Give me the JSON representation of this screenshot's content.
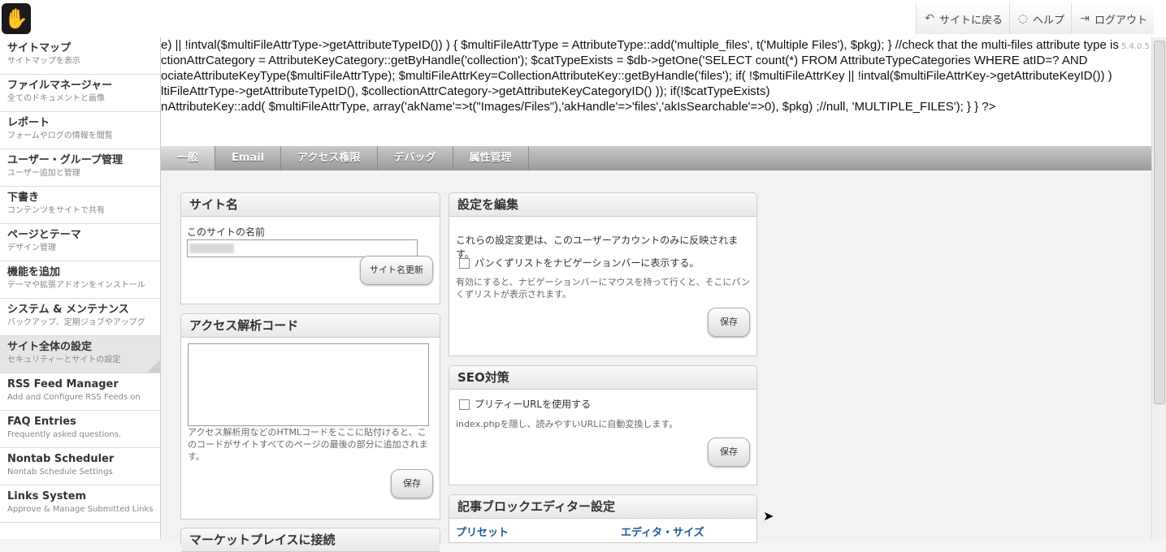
{
  "header": {
    "logo_glyph": "✋",
    "nav": [
      {
        "label": "サイトに戻る",
        "icon": "return-icon"
      },
      {
        "label": "ヘルプ",
        "icon": "help-icon"
      },
      {
        "label": "ログアウト",
        "icon": "logout-icon"
      }
    ]
  },
  "sidebar": {
    "items": [
      {
        "title": "サイトマップ",
        "sub": "サイトマップを表示"
      },
      {
        "title": "ファイルマネージャー",
        "sub": "全てのドキュメントと画像"
      },
      {
        "title": "レポート",
        "sub": "フォームやログの情報を閲覧"
      },
      {
        "title": "ユーザー・グループ管理",
        "sub": "ユーザー追加と管理"
      },
      {
        "title": "下書き",
        "sub": "コンテンツをサイトで共有"
      },
      {
        "title": "ページとテーマ",
        "sub": "デザイン管理"
      },
      {
        "title": "機能を追加",
        "sub": "テーマや拡張アドオンをインストール"
      },
      {
        "title": "システム & メンテナンス",
        "sub": "バックアップ、定期ジョブやアップグ"
      },
      {
        "title": "サイト全体の設定",
        "sub": "セキュリティーとサイトの設定",
        "active": true
      },
      {
        "title": "RSS Feed Manager",
        "sub": "Add and Configure RSS Feeds on"
      },
      {
        "title": "FAQ Entries",
        "sub": "Frequently asked questions."
      },
      {
        "title": "Nontab Scheduler",
        "sub": "Nontab Schedule Settings"
      },
      {
        "title": "Links System",
        "sub": "Approve & Manage Submitted Links"
      }
    ]
  },
  "error_lines": [
    "e) || !intval($multiFileAttrType->getAttributeTypeID()) ) { $multiFileAttrType = AttributeType::add('multiple_files', t('Multiple Files'), $pkg); } //check that the multi-files attribute type is",
    "ctionAttrCategory = AttributeKeyCategory::getByHandle('collection'); $catTypeExists = $db->getOne('SELECT count(*) FROM AttributeTypeCategories WHERE atID=? AND",
    "ociateAttributeKeyType($multiFileAttrType); $multiFileAttrKey=CollectionAttributeKey::getByHandle('files'); if( !$multiFileAttrKey || !intval($multiFileAttrKey->getAttributeKeyID()) )",
    "ltiFileAttrType->getAttributeTypeID(), $collectionAttrCategory->getAttributeKeyCategoryID() )); if(!$catTypeExists)",
    "nAttributeKey::add( $multiFileAttrType, array('akName'=>t(\"Images/Files\"),'akHandle'=>'files','akIsSearchable'=>0), $pkg) ;//null, 'MULTIPLE_FILES'); } } ?>"
  ],
  "version": "5.4.0.5",
  "tabs": [
    "一般",
    "Email",
    "アクセス権限",
    "デバッグ",
    "属性管理"
  ],
  "panels": {
    "site_name": {
      "title": "サイト名",
      "label": "このサイトの名前",
      "value": "",
      "button": "サイト名更新"
    },
    "analytics": {
      "title": "アクセス解析コード",
      "help": "アクセス解析用などのHTMLコードをここに貼付けると、このコードがサイトすべてのページの最後の部分に追加されます。",
      "button": "保存"
    },
    "edit_settings": {
      "title": "設定を編集",
      "desc": "これらの設定変更は、このユーザーアカウントのみに反映されます。",
      "checkbox": "パンくずリストをナビゲーションバーに表示する。",
      "note": "有効にすると、ナビゲーションバーにマウスを持って行くと、そこにパンくずリストが表示されます。",
      "button": "保存"
    },
    "seo": {
      "title": "SEO対策",
      "checkbox": "プリティーURLを使用する",
      "note": "index.phpを隠し、読みやすいURLに自動変換します。",
      "button": "保存"
    },
    "editor": {
      "title": "記事ブロックエディター設定",
      "col1": "プリセット",
      "col2": "エディタ・サイズ"
    },
    "marketplace": {
      "title": "マーケットプレイスに接続"
    }
  }
}
